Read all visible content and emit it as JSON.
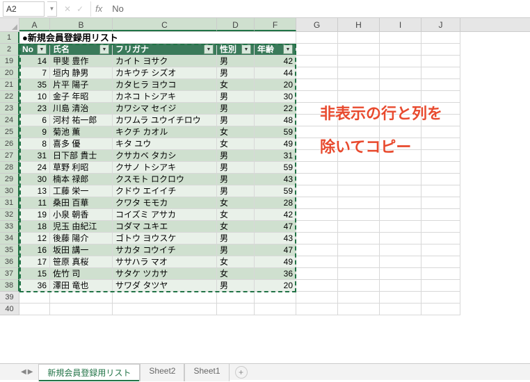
{
  "name_box": "A2",
  "formula_value": "No",
  "overlay": {
    "line1": "非表示の行と列を",
    "line2": "除いてコピー"
  },
  "columns": [
    {
      "letter": "A",
      "width": 44,
      "selected": true
    },
    {
      "letter": "B",
      "width": 90,
      "selected": true
    },
    {
      "letter": "C",
      "width": 150,
      "selected": true
    },
    {
      "letter": "D",
      "width": 54,
      "selected": true
    },
    {
      "letter": "F",
      "width": 60,
      "selected": true
    },
    {
      "letter": "G",
      "width": 60,
      "selected": false
    },
    {
      "letter": "H",
      "width": 60,
      "selected": false
    },
    {
      "letter": "I",
      "width": 60,
      "selected": false
    },
    {
      "letter": "J",
      "width": 56,
      "selected": false
    }
  ],
  "title_row": {
    "num": "1",
    "text": "●新規会員登録用リスト"
  },
  "header_row": {
    "num": "2",
    "cells": [
      "No",
      "氏名",
      "フリガナ",
      "性別",
      "年齢"
    ]
  },
  "data_rows": [
    {
      "num": "19",
      "no": 14,
      "name": "甲斐 豊作",
      "kana": "カイト ヨサク",
      "sex": "男",
      "age": 42
    },
    {
      "num": "20",
      "no": 7,
      "name": "垣内 静男",
      "kana": "カキウチ シズオ",
      "sex": "男",
      "age": 44
    },
    {
      "num": "21",
      "no": 35,
      "name": "片平 陽子",
      "kana": "カタヒラ ヨウコ",
      "sex": "女",
      "age": 20
    },
    {
      "num": "22",
      "no": 10,
      "name": "金子 年昭",
      "kana": "カネコ トシアキ",
      "sex": "男",
      "age": 30
    },
    {
      "num": "23",
      "no": 23,
      "name": "川島 清治",
      "kana": "カワシマ セイジ",
      "sex": "男",
      "age": 22
    },
    {
      "num": "24",
      "no": 6,
      "name": "河村 祐一郎",
      "kana": "カワムラ ユウイチロウ",
      "sex": "男",
      "age": 48
    },
    {
      "num": "25",
      "no": 9,
      "name": "菊池 薫",
      "kana": "キクチ カオル",
      "sex": "女",
      "age": 59
    },
    {
      "num": "26",
      "no": 8,
      "name": "喜多 優",
      "kana": "キタ ユウ",
      "sex": "女",
      "age": 49
    },
    {
      "num": "27",
      "no": 31,
      "name": "日下部 貴士",
      "kana": "クサカベ タカシ",
      "sex": "男",
      "age": 31
    },
    {
      "num": "28",
      "no": 24,
      "name": "草野 利昭",
      "kana": "クサノ トシアキ",
      "sex": "男",
      "age": 59
    },
    {
      "num": "29",
      "no": 30,
      "name": "楠本 禄郎",
      "kana": "クスモト ロクロウ",
      "sex": "男",
      "age": 43
    },
    {
      "num": "30",
      "no": 13,
      "name": "工藤 栄一",
      "kana": "クドウ エイイチ",
      "sex": "男",
      "age": 59
    },
    {
      "num": "31",
      "no": 11,
      "name": "桑田 百華",
      "kana": "クワタ モモカ",
      "sex": "女",
      "age": 28
    },
    {
      "num": "32",
      "no": 19,
      "name": "小泉 朝香",
      "kana": "コイズミ アサカ",
      "sex": "女",
      "age": 42
    },
    {
      "num": "33",
      "no": 18,
      "name": "児玉 由紀江",
      "kana": "コダマ ユキエ",
      "sex": "女",
      "age": 47
    },
    {
      "num": "34",
      "no": 12,
      "name": "後藤 陽介",
      "kana": "ゴトウ ヨウスケ",
      "sex": "男",
      "age": 43
    },
    {
      "num": "35",
      "no": 16,
      "name": "坂田 講一",
      "kana": "サカタ コウイチ",
      "sex": "男",
      "age": 47
    },
    {
      "num": "36",
      "no": 17,
      "name": "笹原 真桜",
      "kana": "ササハラ マオ",
      "sex": "女",
      "age": 49
    },
    {
      "num": "37",
      "no": 15,
      "name": "佐竹 司",
      "kana": "サタケ ツカサ",
      "sex": "女",
      "age": 36
    },
    {
      "num": "38",
      "no": 36,
      "name": "澤田 竜也",
      "kana": "サワダ タツヤ",
      "sex": "男",
      "age": 20
    }
  ],
  "empty_rows": [
    "39",
    "40"
  ],
  "tabs": [
    {
      "label": "新規会員登録用リスト",
      "active": true
    },
    {
      "label": "Sheet2",
      "active": false
    },
    {
      "label": "Sheet1",
      "active": false
    }
  ]
}
